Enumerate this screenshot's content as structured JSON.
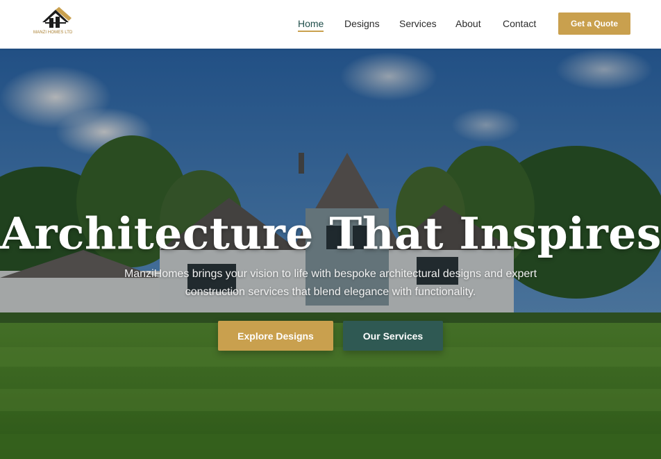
{
  "brand": {
    "logo_text": "MANZI HOMES LTD",
    "colors": {
      "gold": "#c9a04e",
      "teal": "#2f5953",
      "nav_text": "#2b2b2b"
    }
  },
  "nav": {
    "items": [
      {
        "label": "Home",
        "active": true
      },
      {
        "label": "Designs",
        "active": false
      },
      {
        "label": "Services",
        "active": false
      },
      {
        "label": "About",
        "active": false
      },
      {
        "label": "Contact",
        "active": false
      }
    ],
    "cta_label": "Get a Quote"
  },
  "hero": {
    "title": "Architecture That Inspires",
    "subtitle": "ManziHomes brings your vision to life with bespoke architectural designs and expert construction services that blend elegance with functionality.",
    "primary_button": "Explore Designs",
    "secondary_button": "Our Services"
  }
}
